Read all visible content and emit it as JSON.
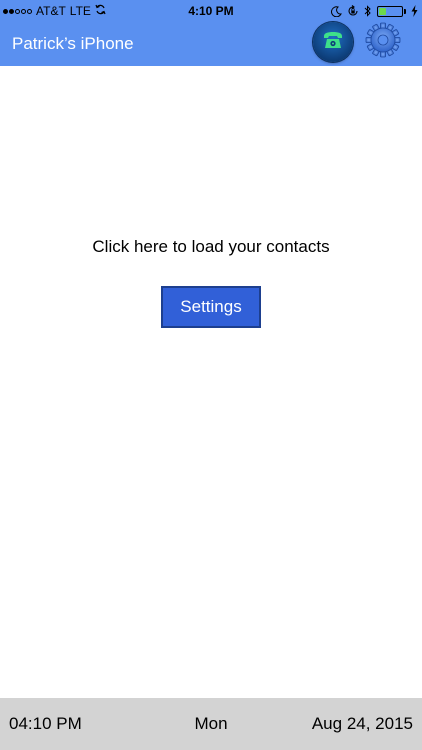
{
  "status_bar": {
    "carrier": "AT&T",
    "network": "LTE",
    "time": "4:10 PM",
    "signal_bars_filled": 2,
    "signal_bars_total": 5,
    "battery_level": 0.3,
    "battery_color": "#6cd84a",
    "icons": [
      "sync-icon",
      "moon-icon",
      "rotation-lock-icon",
      "bluetooth-icon",
      "battery-icon",
      "charging-icon"
    ]
  },
  "header": {
    "title": "Patrick’s iPhone",
    "background_color": "#5a90f0",
    "phone_icon_color": "#3ee08a"
  },
  "main": {
    "prompt": "Click here to load your contacts",
    "settings_label": "Settings",
    "button_color": "#3160d8"
  },
  "footer": {
    "time": "04:10 PM",
    "day": "Mon",
    "date": "Aug 24, 2015"
  }
}
